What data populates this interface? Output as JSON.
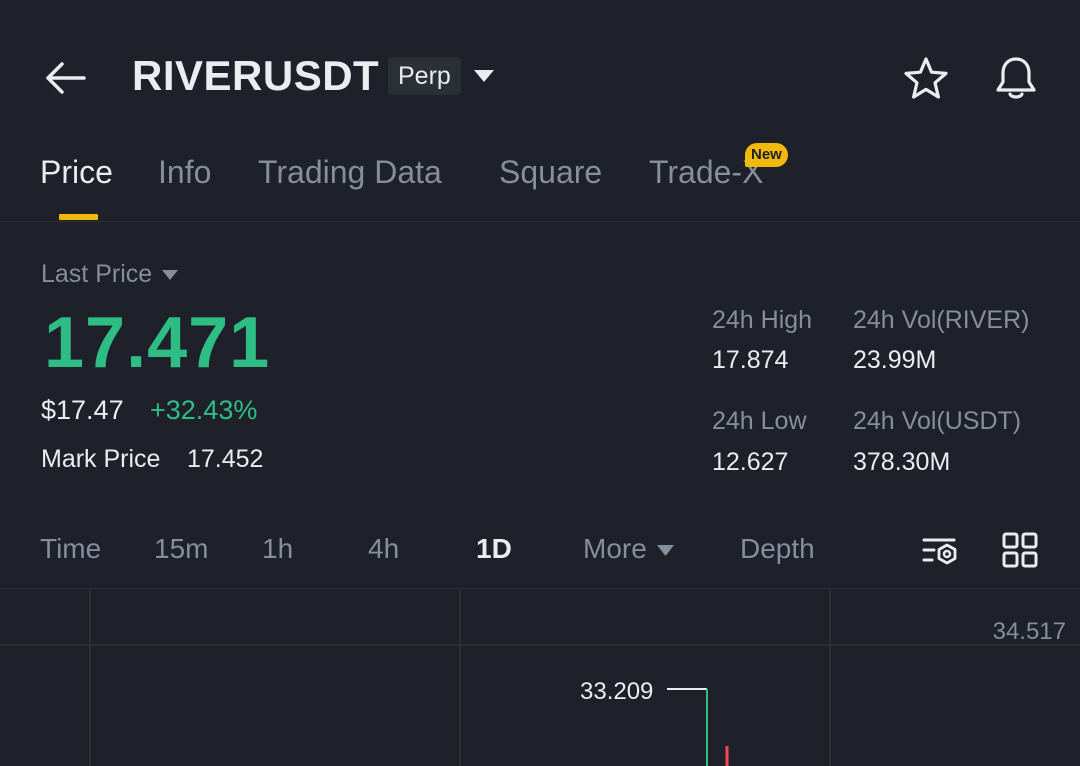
{
  "header": {
    "symbol": "RIVERUSDT",
    "contract_type": "Perp"
  },
  "tabs": [
    {
      "label": "Price",
      "active": true
    },
    {
      "label": "Info"
    },
    {
      "label": "Trading Data"
    },
    {
      "label": "Square"
    },
    {
      "label": "Trade-X",
      "badge": "New"
    }
  ],
  "price": {
    "label": "Last Price",
    "last": "17.471",
    "usd": "$17.47",
    "change": "+32.43%",
    "mark_label": "Mark Price",
    "mark_value": "17.452"
  },
  "stats": {
    "high_label": "24h High",
    "high_value": "17.874",
    "low_label": "24h Low",
    "low_value": "12.627",
    "vol_base_label": "24h Vol(RIVER)",
    "vol_base_value": "23.99M",
    "vol_quote_label": "24h Vol(USDT)",
    "vol_quote_value": "378.30M"
  },
  "intervals": [
    {
      "label": "Time"
    },
    {
      "label": "15m"
    },
    {
      "label": "1h"
    },
    {
      "label": "4h"
    },
    {
      "label": "1D",
      "active": true
    },
    {
      "label": "More"
    },
    {
      "label": "Depth"
    }
  ],
  "chart": {
    "axis_top_label": "34.517",
    "high_marker": "33.209"
  },
  "colors": {
    "background": "#1e2129",
    "up": "#2ebd85",
    "down": "#f6465d",
    "accent": "#f0b90b",
    "muted": "#848e9c",
    "text": "#eaecef"
  },
  "icons": {
    "back": "arrow-left-icon",
    "dropdown": "caret-down-icon",
    "favorite": "star-icon",
    "alert": "bell-icon",
    "indicators": "chart-settings-icon",
    "layout": "grid-icon"
  }
}
